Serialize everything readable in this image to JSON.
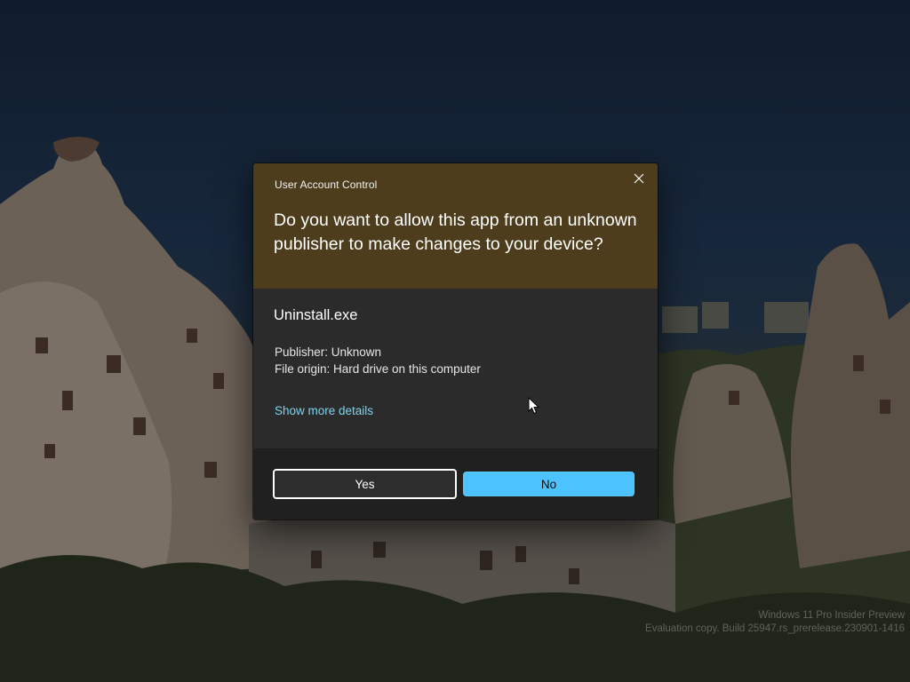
{
  "dialog": {
    "window_title": "User Account Control",
    "question": "Do you want to allow this app from an unknown publisher to make changes to your device?",
    "app_name": "Uninstall.exe",
    "publisher": "Publisher: Unknown",
    "file_origin": "File origin: Hard drive on this computer",
    "show_more_details": "Show more details",
    "yes_label": "Yes",
    "no_label": "No",
    "close_icon": "close-icon",
    "colors": {
      "header": "#4d3d1c",
      "body": "#2b2b2b",
      "footer": "#202020",
      "accent": "#4cc2ff",
      "link": "#7fd3ec"
    }
  },
  "watermark": {
    "line1": "Windows 11 Pro Insider Preview",
    "line2": "Evaluation copy. Build 25947.rs_prerelease.230901-1416"
  },
  "cursor_icon": "mouse-pointer-icon"
}
